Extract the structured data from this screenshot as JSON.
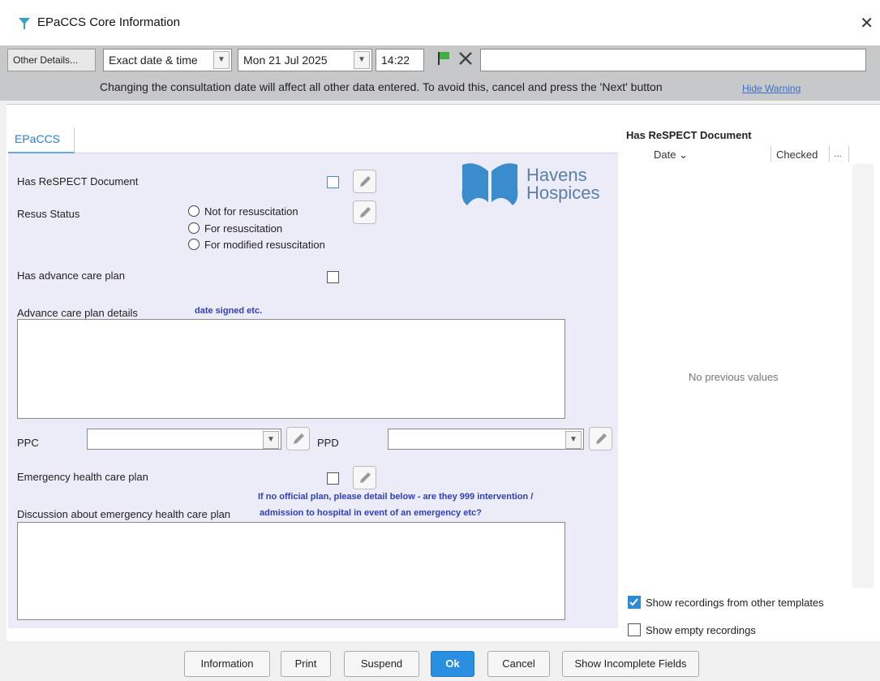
{
  "window": {
    "title": "EPaCCS Core Information",
    "close_symbol": "✕"
  },
  "toolbar": {
    "other_details_label": "Other Details...",
    "date_mode_value": "Exact date & time",
    "date_value": "Mon 21 Jul 2025",
    "time_value": "14:22",
    "free_text_value": "",
    "flag_color": "#3cb043"
  },
  "warning": {
    "text": "Changing the consultation date will affect all other data entered. To avoid this, cancel and press the 'Next' button",
    "hide_link": "Hide Warning"
  },
  "tabs": [
    {
      "label": "EPaCCS"
    }
  ],
  "logo": {
    "line1": "Havens",
    "line2": "Hospices",
    "color": "#5a7fa8"
  },
  "form": {
    "respect_label": "Has ReSPECT Document",
    "resus_label": "Resus Status",
    "resus_options": [
      "Not for resuscitation",
      "For resuscitation",
      "For modified resuscitation"
    ],
    "acp_label": "Has advance care plan",
    "acp_details_label": "Advance care plan details",
    "acp_details_hint": "date signed etc.",
    "acp_details_value": "",
    "ppc_label": "PPC",
    "ppc_value": "",
    "ppd_label": "PPD",
    "ppd_value": "",
    "ehcp_label": "Emergency health care plan",
    "ehcp_hint_line1": "If no official plan, please detail below - are they 999 intervention /",
    "ehcp_hint_line2": "admission to hospital in event of an emergency etc?",
    "ehcp_discussion_label": "Discussion about emergency health care plan",
    "ehcp_discussion_value": ""
  },
  "history": {
    "title": "Has ReSPECT Document",
    "col_date": "Date",
    "col_checked": "Checked",
    "col_more": "...",
    "empty_text": "No previous values",
    "show_other_templates": {
      "label": "Show recordings from other templates",
      "checked": true
    },
    "show_empty": {
      "label": "Show empty recordings",
      "checked": false
    }
  },
  "buttons": {
    "information": "Information",
    "print": "Print",
    "suspend": "Suspend",
    "ok": "Ok",
    "cancel": "Cancel",
    "show_incomplete": "Show Incomplete Fields"
  }
}
